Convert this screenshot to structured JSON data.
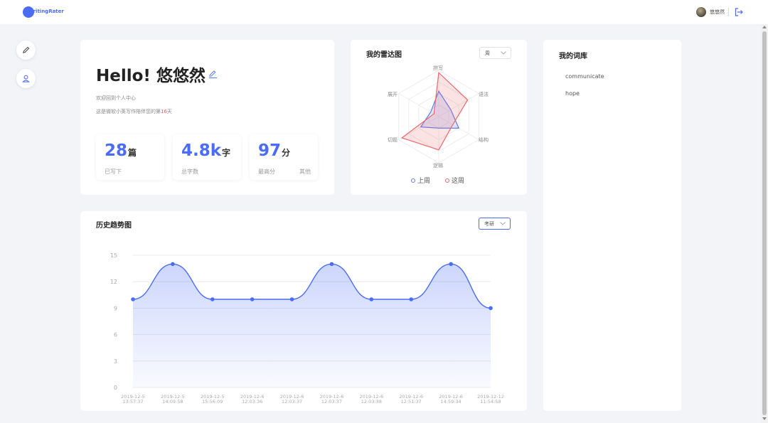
{
  "header": {
    "logo_text": "WritingRater",
    "username": "悠悠然",
    "brand_color": "#4a6cf7",
    "logout_icon": "logout-icon"
  },
  "sidebar": {
    "buttons": [
      {
        "name": "pen-icon"
      },
      {
        "name": "user-icon"
      }
    ]
  },
  "profile": {
    "greeting": "Hello! 悠悠然",
    "welcome": "欢迎回到个人中心",
    "days_prefix": "这是微软小英写作陪伴您的第",
    "days_count": "16",
    "days_suffix": "天",
    "stats": [
      {
        "value": "28",
        "unit": "篇",
        "label": "已写下",
        "extra": ""
      },
      {
        "value": "4.8k",
        "unit": "字",
        "label": "总字数",
        "extra": ""
      },
      {
        "value": "97",
        "unit": "分",
        "label": "最高分",
        "extra": "其他"
      }
    ]
  },
  "radar": {
    "title": "我的雷达图",
    "period_select": "周",
    "axes": [
      "拼写",
      "语法",
      "结构",
      "逻辑",
      "切题",
      "展开"
    ],
    "legend": [
      "上周",
      "这周"
    ],
    "series": [
      {
        "name": "上周",
        "color": "#5b7cf0",
        "values": [
          0.55,
          0.3,
          0.5,
          0.25,
          0.45,
          0.2
        ]
      },
      {
        "name": "这周",
        "color": "#ee6666",
        "values": [
          0.95,
          0.72,
          0.35,
          0.72,
          0.92,
          0.12
        ]
      }
    ]
  },
  "vocab": {
    "title": "我的词库",
    "words": [
      "communicate",
      "hope"
    ]
  },
  "trend": {
    "title": "历史趋势图",
    "filter_select": "考研"
  },
  "chart_data": {
    "type": "area",
    "title": "历史趋势图",
    "categories": [
      [
        "2019-12-5",
        "13:57:37"
      ],
      [
        "2019-12-5",
        "14:09:58"
      ],
      [
        "2019-12-5",
        "15:56:09"
      ],
      [
        "2019-12-6",
        "12:03:36"
      ],
      [
        "2019-12-6",
        "12:03:37"
      ],
      [
        "2019-12-6",
        "12:03:37"
      ],
      [
        "2019-12-6",
        "12:03:38"
      ],
      [
        "2019-12-6",
        "12:51:37"
      ],
      [
        "2019-12-6",
        "14:59:34"
      ],
      [
        "2019-12-12",
        "11:54:58"
      ]
    ],
    "values": [
      10,
      14,
      10,
      10,
      10,
      14,
      10,
      10,
      14,
      9
    ],
    "ylim": [
      0,
      15
    ],
    "yticks": [
      "0",
      "3",
      "6",
      "9",
      "12",
      "15"
    ],
    "grid": true,
    "color": "#4a6cf7"
  }
}
